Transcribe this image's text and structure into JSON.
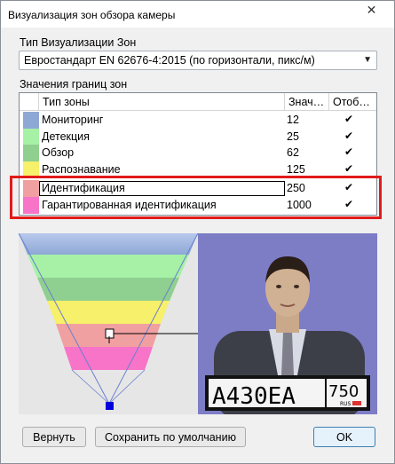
{
  "window": {
    "title": "Визуализация зон обзора камеры",
    "close_glyph": "✕"
  },
  "zone_type": {
    "label": "Тип Визуализации Зон",
    "selected": "Евростандарт EN 62676-4:2015 (по горизонтали, пикс/м)",
    "arrow": "▼"
  },
  "zones": {
    "label": "Значения границ зон",
    "columns": [
      "Тип зоны",
      "Знач…",
      "Отоб…"
    ],
    "check_glyph": "✔",
    "rows": [
      {
        "name": "Мониторинг",
        "value": "12",
        "shown": true,
        "color": "#8ea8d6"
      },
      {
        "name": "Детекция",
        "value": "25",
        "shown": true,
        "color": "#a6f1a6"
      },
      {
        "name": "Обзор",
        "value": "62",
        "shown": true,
        "color": "#8fcf8f"
      },
      {
        "name": "Распознавание",
        "value": "125",
        "shown": true,
        "color": "#f6f06a"
      },
      {
        "name": "Идентификация",
        "value": "250",
        "shown": true,
        "color": "#f0a0a0"
      },
      {
        "name": "Гарантированная идентификация",
        "value": "1000",
        "shown": true,
        "color": "#f774c8"
      }
    ]
  },
  "preview": {
    "plate_main": "А430ЕА",
    "plate_region": "750",
    "plate_country": "RUS"
  },
  "buttons": {
    "revert": "Вернуть",
    "save_default": "Сохранить по умолчанию",
    "ok": "OK"
  },
  "colors": {
    "highlight": "#e11b1b",
    "camera": "#0000dd"
  }
}
